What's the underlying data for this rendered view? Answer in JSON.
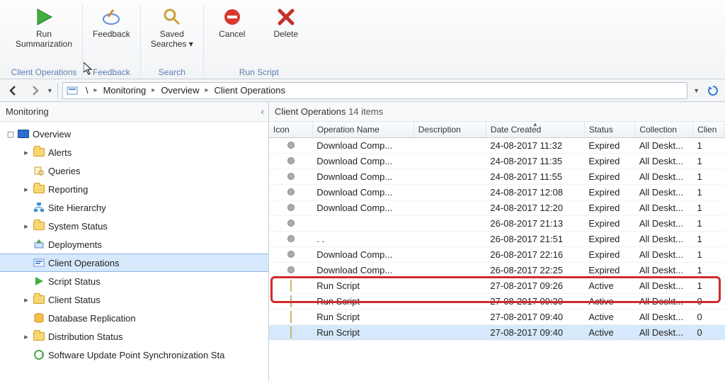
{
  "ribbon": {
    "groups": [
      {
        "label": "Client Operations",
        "buttons": [
          {
            "label": "Run\nSummarization",
            "icon": "play-green"
          }
        ]
      },
      {
        "label": "Feedback",
        "buttons": [
          {
            "label": "Feedback",
            "icon": "pencil"
          }
        ]
      },
      {
        "label": "Search",
        "buttons": [
          {
            "label": "Saved\nSearches ▾",
            "icon": "magnifier"
          }
        ]
      },
      {
        "label": "Run Script",
        "buttons": [
          {
            "label": "Cancel",
            "icon": "cancel-red"
          },
          {
            "label": "Delete",
            "icon": "delete-x"
          }
        ]
      }
    ]
  },
  "breadcrumb": {
    "root": "\\",
    "items": [
      "Monitoring",
      "Overview",
      "Client Operations"
    ]
  },
  "leftnav": {
    "title": "Monitoring",
    "items": [
      {
        "label": "Overview",
        "icon": "screen",
        "level": 1,
        "expander": "▢",
        "selected": false
      },
      {
        "label": "Alerts",
        "icon": "folder",
        "level": 2,
        "expander": "▸"
      },
      {
        "label": "Queries",
        "icon": "queries",
        "level": 2,
        "expander": ""
      },
      {
        "label": "Reporting",
        "icon": "folder",
        "level": 2,
        "expander": "▸"
      },
      {
        "label": "Site Hierarchy",
        "icon": "hierarchy",
        "level": 2,
        "expander": ""
      },
      {
        "label": "System Status",
        "icon": "folder",
        "level": 2,
        "expander": "▸"
      },
      {
        "label": "Deployments",
        "icon": "deploy",
        "level": 2,
        "expander": ""
      },
      {
        "label": "Client Operations",
        "icon": "clientops",
        "level": 2,
        "expander": "",
        "selected": true
      },
      {
        "label": "Script Status",
        "icon": "play",
        "level": 2,
        "expander": ""
      },
      {
        "label": "Client Status",
        "icon": "folder",
        "level": 2,
        "expander": "▸"
      },
      {
        "label": "Database Replication",
        "icon": "db",
        "level": 2,
        "expander": ""
      },
      {
        "label": "Distribution Status",
        "icon": "folder",
        "level": 2,
        "expander": "▸"
      },
      {
        "label": "Software Update Point Synchronization Sta",
        "icon": "sync",
        "level": 2,
        "expander": ""
      }
    ]
  },
  "grid": {
    "title": "Client Operations",
    "count_label": "14 items",
    "columns": [
      "Icon",
      "Operation Name",
      "Description",
      "Date Created",
      "Status",
      "Collection",
      "Clien"
    ],
    "sort_col": 3,
    "rows": [
      {
        "icon": "dot",
        "op": "Download Comp...",
        "desc": "",
        "date": "24-08-2017 11:32",
        "status": "Expired",
        "coll": "All Deskt...",
        "cli": "1"
      },
      {
        "icon": "dot",
        "op": "Download Comp...",
        "desc": "",
        "date": "24-08-2017 11:35",
        "status": "Expired",
        "coll": "All Deskt...",
        "cli": "1"
      },
      {
        "icon": "dot",
        "op": "Download Comp...",
        "desc": "",
        "date": "24-08-2017 11:55",
        "status": "Expired",
        "coll": "All Deskt...",
        "cli": "1"
      },
      {
        "icon": "dot",
        "op": "Download Comp...",
        "desc": "",
        "date": "24-08-2017 12:08",
        "status": "Expired",
        "coll": "All Deskt...",
        "cli": "1"
      },
      {
        "icon": "dot",
        "op": "Download Comp...",
        "desc": "",
        "date": "24-08-2017 12:20",
        "status": "Expired",
        "coll": "All Deskt...",
        "cli": "1"
      },
      {
        "icon": "dot",
        "op": "",
        "desc": "",
        "date": "26-08-2017 21:13",
        "status": "Expired",
        "coll": "All Deskt...",
        "cli": "1"
      },
      {
        "icon": "dot",
        "op": ". .",
        "desc": "",
        "date": "26-08-2017 21:51",
        "status": "Expired",
        "coll": "All Deskt...",
        "cli": "1"
      },
      {
        "icon": "dot",
        "op": "Download Comp...",
        "desc": "",
        "date": "26-08-2017 22:16",
        "status": "Expired",
        "coll": "All Deskt...",
        "cli": "1"
      },
      {
        "icon": "dot",
        "op": "Download Comp...",
        "desc": "",
        "date": "26-08-2017 22:25",
        "status": "Expired",
        "coll": "All Deskt...",
        "cli": "1"
      },
      {
        "icon": "script",
        "op": "Run Script",
        "desc": "",
        "date": "27-08-2017 09:26",
        "status": "Active",
        "coll": "All Deskt...",
        "cli": "1",
        "highlight": true
      },
      {
        "icon": "script",
        "op": "Run Script",
        "desc": "",
        "date": "27-08-2017 09:30",
        "status": "Active",
        "coll": "All Deskt...",
        "cli": "0"
      },
      {
        "icon": "script",
        "op": "Run Script",
        "desc": "",
        "date": "27-08-2017 09:40",
        "status": "Active",
        "coll": "All Deskt...",
        "cli": "0"
      },
      {
        "icon": "script",
        "op": "Run Script",
        "desc": "",
        "date": "27-08-2017 09:40",
        "status": "Active",
        "coll": "All Deskt...",
        "cli": "0",
        "selected": true
      }
    ]
  }
}
